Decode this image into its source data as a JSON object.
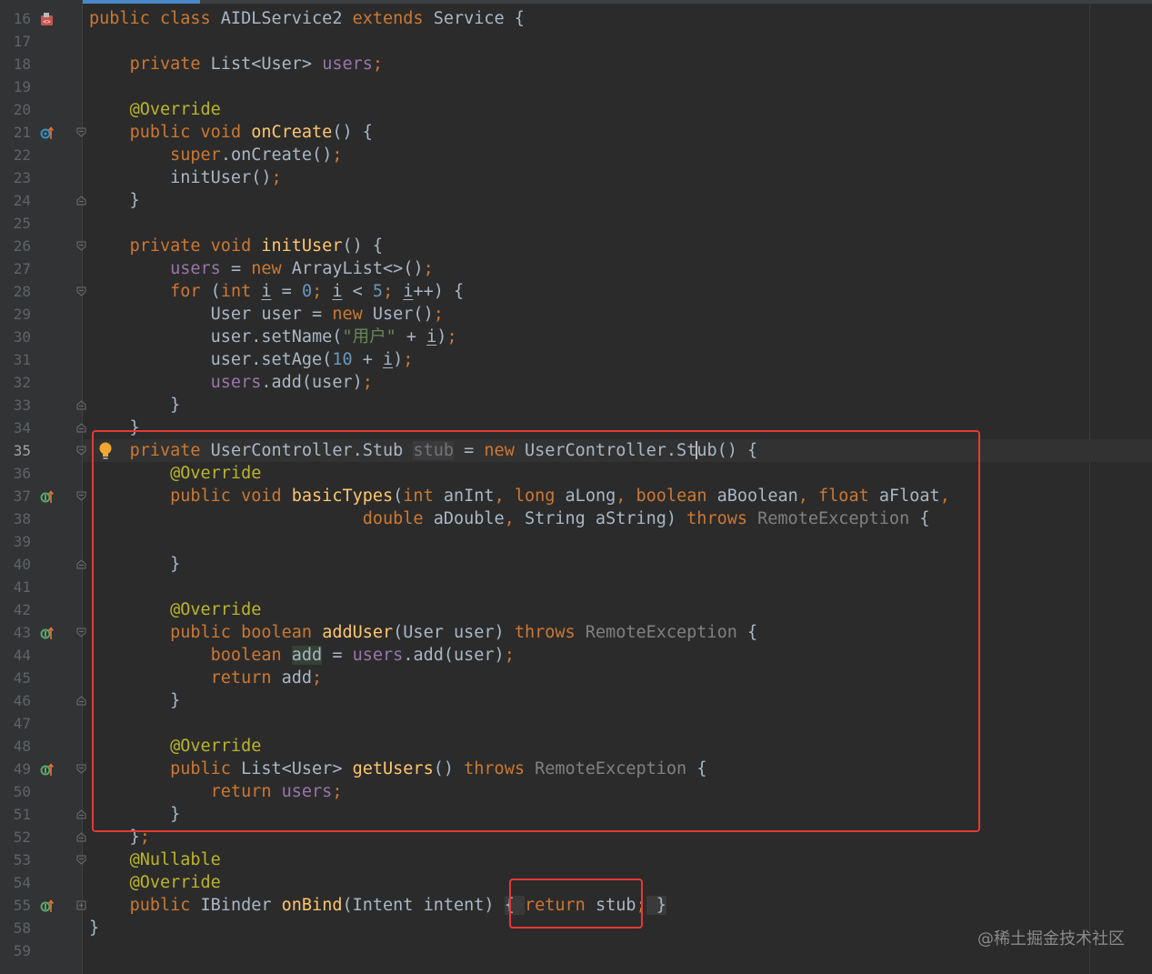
{
  "editor": {
    "watermark": "@稀土掘金技术社区",
    "caret_line": "35",
    "lines": [
      {
        "n": "16",
        "icon": "class-icon",
        "fold": "",
        "tokens": [
          [
            "kw",
            "public class "
          ],
          [
            "",
            "AIDLService2 "
          ],
          [
            "kw",
            "extends "
          ],
          [
            "",
            "Service {"
          ]
        ]
      },
      {
        "n": "17",
        "icon": "",
        "fold": "",
        "tokens": []
      },
      {
        "n": "18",
        "icon": "",
        "fold": "",
        "tokens": [
          [
            "",
            "    "
          ],
          [
            "kw",
            "private "
          ],
          [
            "",
            "List<User> "
          ],
          [
            "fd",
            "users"
          ],
          [
            "kw",
            ";"
          ]
        ]
      },
      {
        "n": "19",
        "icon": "",
        "fold": "",
        "tokens": []
      },
      {
        "n": "20",
        "icon": "",
        "fold": "",
        "tokens": [
          [
            "",
            "    "
          ],
          [
            "an",
            "@Override"
          ]
        ]
      },
      {
        "n": "21",
        "icon": "override-up-blue-icon",
        "fold": "open",
        "tokens": [
          [
            "",
            "    "
          ],
          [
            "kw",
            "public void "
          ],
          [
            "fn",
            "onCreate"
          ],
          [
            "",
            "() {"
          ]
        ]
      },
      {
        "n": "22",
        "icon": "",
        "fold": "",
        "tokens": [
          [
            "",
            "        "
          ],
          [
            "kw",
            "super"
          ],
          [
            "",
            ".onCreate()"
          ],
          [
            "kw",
            ";"
          ]
        ]
      },
      {
        "n": "23",
        "icon": "",
        "fold": "",
        "tokens": [
          [
            "",
            "        initUser()"
          ],
          [
            "kw",
            ";"
          ]
        ]
      },
      {
        "n": "24",
        "icon": "",
        "fold": "close",
        "tokens": [
          [
            "",
            "    }"
          ]
        ]
      },
      {
        "n": "25",
        "icon": "",
        "fold": "",
        "tokens": []
      },
      {
        "n": "26",
        "icon": "",
        "fold": "open",
        "tokens": [
          [
            "",
            "    "
          ],
          [
            "kw",
            "private void "
          ],
          [
            "fn",
            "initUser"
          ],
          [
            "",
            "() {"
          ]
        ]
      },
      {
        "n": "27",
        "icon": "",
        "fold": "",
        "tokens": [
          [
            "",
            "        "
          ],
          [
            "fd",
            "users"
          ],
          [
            "",
            " = "
          ],
          [
            "kw",
            "new "
          ],
          [
            "",
            "ArrayList<>()"
          ],
          [
            "kw",
            ";"
          ]
        ]
      },
      {
        "n": "28",
        "icon": "",
        "fold": "open",
        "tokens": [
          [
            "",
            "        "
          ],
          [
            "kw",
            "for "
          ],
          [
            "",
            "("
          ],
          [
            "kw",
            "int "
          ],
          [
            "ul",
            "i"
          ],
          [
            "",
            " = "
          ],
          [
            "nm",
            "0"
          ],
          [
            "kw",
            "; "
          ],
          [
            "ul",
            "i"
          ],
          [
            "",
            " < "
          ],
          [
            "nm",
            "5"
          ],
          [
            "kw",
            "; "
          ],
          [
            "ul",
            "i"
          ],
          [
            "",
            "++) {"
          ]
        ]
      },
      {
        "n": "29",
        "icon": "",
        "fold": "",
        "tokens": [
          [
            "",
            "            User user = "
          ],
          [
            "kw",
            "new "
          ],
          [
            "",
            "User()"
          ],
          [
            "kw",
            ";"
          ]
        ]
      },
      {
        "n": "30",
        "icon": "",
        "fold": "",
        "tokens": [
          [
            "",
            "            user.setName("
          ],
          [
            "st",
            "\"用户\""
          ],
          [
            "",
            " + "
          ],
          [
            "ul",
            "i"
          ],
          [
            "",
            ")"
          ],
          [
            "kw",
            ";"
          ]
        ]
      },
      {
        "n": "31",
        "icon": "",
        "fold": "",
        "tokens": [
          [
            "",
            "            user.setAge("
          ],
          [
            "nm",
            "10"
          ],
          [
            "",
            " + "
          ],
          [
            "ul",
            "i"
          ],
          [
            "",
            ")"
          ],
          [
            "kw",
            ";"
          ]
        ]
      },
      {
        "n": "32",
        "icon": "",
        "fold": "",
        "tokens": [
          [
            "",
            "            "
          ],
          [
            "fd",
            "users"
          ],
          [
            "",
            ".add(user)"
          ],
          [
            "kw",
            ";"
          ]
        ]
      },
      {
        "n": "33",
        "icon": "",
        "fold": "close",
        "tokens": [
          [
            "",
            "        }"
          ]
        ]
      },
      {
        "n": "34",
        "icon": "",
        "fold": "close",
        "tokens": [
          [
            "",
            "    }"
          ]
        ]
      },
      {
        "n": "35",
        "icon": "bulb",
        "fold": "open",
        "tokens": [
          [
            "",
            "    "
          ],
          [
            "kw",
            "private "
          ],
          [
            "",
            "UserController.Stub "
          ],
          [
            "hl-unused",
            "stub"
          ],
          [
            "",
            " = "
          ],
          [
            "kw",
            "new "
          ],
          [
            "",
            "UserController.St"
          ],
          [
            "caret",
            ""
          ],
          [
            "",
            "ub() {"
          ]
        ]
      },
      {
        "n": "36",
        "icon": "",
        "fold": "",
        "tokens": [
          [
            "",
            "        "
          ],
          [
            "an",
            "@Override"
          ]
        ]
      },
      {
        "n": "37",
        "icon": "implement-up-green-icon",
        "fold": "open",
        "tokens": [
          [
            "",
            "        "
          ],
          [
            "kw",
            "public void "
          ],
          [
            "fn",
            "basicTypes"
          ],
          [
            "",
            "("
          ],
          [
            "kw",
            "int "
          ],
          [
            "",
            "anInt"
          ],
          [
            "kw",
            ", "
          ],
          [
            "kw",
            "long "
          ],
          [
            "",
            "aLong"
          ],
          [
            "kw",
            ", "
          ],
          [
            "kw",
            "boolean "
          ],
          [
            "",
            "aBoolean"
          ],
          [
            "kw",
            ", "
          ],
          [
            "kw",
            "float "
          ],
          [
            "",
            "aFloat"
          ],
          [
            "kw",
            ","
          ]
        ]
      },
      {
        "n": "38",
        "icon": "",
        "fold": "",
        "tokens": [
          [
            "",
            "                           "
          ],
          [
            "kw",
            "double "
          ],
          [
            "",
            "aDouble"
          ],
          [
            "kw",
            ", "
          ],
          [
            "",
            "String aString) "
          ],
          [
            "kw",
            "throws "
          ],
          [
            "gr",
            "RemoteException"
          ],
          [
            "",
            " {"
          ]
        ]
      },
      {
        "n": "39",
        "icon": "",
        "fold": "",
        "tokens": []
      },
      {
        "n": "40",
        "icon": "",
        "fold": "close",
        "tokens": [
          [
            "",
            "        }"
          ]
        ]
      },
      {
        "n": "41",
        "icon": "",
        "fold": "",
        "tokens": []
      },
      {
        "n": "42",
        "icon": "",
        "fold": "",
        "tokens": [
          [
            "",
            "        "
          ],
          [
            "an",
            "@Override"
          ]
        ]
      },
      {
        "n": "43",
        "icon": "implement-up-green-icon",
        "fold": "open",
        "tokens": [
          [
            "",
            "        "
          ],
          [
            "kw",
            "public boolean "
          ],
          [
            "fn",
            "addUser"
          ],
          [
            "",
            "(User user) "
          ],
          [
            "kw",
            "throws "
          ],
          [
            "gr",
            "RemoteException"
          ],
          [
            "",
            " {"
          ]
        ]
      },
      {
        "n": "44",
        "icon": "",
        "fold": "",
        "tokens": [
          [
            "",
            "            "
          ],
          [
            "kw",
            "boolean "
          ],
          [
            "hl-add",
            "add"
          ],
          [
            "",
            " = "
          ],
          [
            "fd",
            "users"
          ],
          [
            "",
            ".add(user)"
          ],
          [
            "kw",
            ";"
          ]
        ]
      },
      {
        "n": "45",
        "icon": "",
        "fold": "",
        "tokens": [
          [
            "",
            "            "
          ],
          [
            "kw",
            "return "
          ],
          [
            "",
            "add"
          ],
          [
            "kw",
            ";"
          ]
        ]
      },
      {
        "n": "46",
        "icon": "",
        "fold": "close",
        "tokens": [
          [
            "",
            "        }"
          ]
        ]
      },
      {
        "n": "47",
        "icon": "",
        "fold": "",
        "tokens": []
      },
      {
        "n": "48",
        "icon": "",
        "fold": "",
        "tokens": [
          [
            "",
            "        "
          ],
          [
            "an",
            "@Override"
          ]
        ]
      },
      {
        "n": "49",
        "icon": "implement-up-green-icon",
        "fold": "open",
        "tokens": [
          [
            "",
            "        "
          ],
          [
            "kw",
            "public "
          ],
          [
            "",
            "List<User> "
          ],
          [
            "fn",
            "getUsers"
          ],
          [
            "",
            "() "
          ],
          [
            "kw",
            "throws "
          ],
          [
            "gr",
            "RemoteException"
          ],
          [
            "",
            " {"
          ]
        ]
      },
      {
        "n": "50",
        "icon": "",
        "fold": "",
        "tokens": [
          [
            "",
            "            "
          ],
          [
            "kw",
            "return "
          ],
          [
            "fd",
            "users"
          ],
          [
            "kw",
            ";"
          ]
        ]
      },
      {
        "n": "51",
        "icon": "",
        "fold": "close",
        "tokens": [
          [
            "",
            "        }"
          ]
        ]
      },
      {
        "n": "52",
        "icon": "",
        "fold": "close",
        "tokens": [
          [
            "",
            "    }"
          ],
          [
            "kw",
            ";"
          ]
        ]
      },
      {
        "n": "53",
        "icon": "",
        "fold": "open",
        "tokens": [
          [
            "",
            "    "
          ],
          [
            "an",
            "@Nullable"
          ]
        ]
      },
      {
        "n": "54",
        "icon": "",
        "fold": "",
        "tokens": [
          [
            "",
            "    "
          ],
          [
            "an",
            "@Override"
          ]
        ]
      },
      {
        "n": "55",
        "icon": "implement-up-green-icon",
        "fold": "plus",
        "tokens": [
          [
            "",
            "    "
          ],
          [
            "kw",
            "public "
          ],
          [
            "",
            "IBinder "
          ],
          [
            "fn",
            "onBind"
          ],
          [
            "",
            "(Intent intent) "
          ],
          [
            "collapsed",
            "{ "
          ],
          [
            "kw",
            "return "
          ],
          [
            "",
            "stub"
          ],
          [
            "kw",
            ";"
          ],
          [
            "collapsed",
            " }"
          ]
        ]
      },
      {
        "n": "58",
        "icon": "",
        "fold": "",
        "tokens": [
          [
            "",
            "}"
          ]
        ]
      },
      {
        "n": "59",
        "icon": "",
        "fold": "",
        "tokens": []
      }
    ]
  }
}
